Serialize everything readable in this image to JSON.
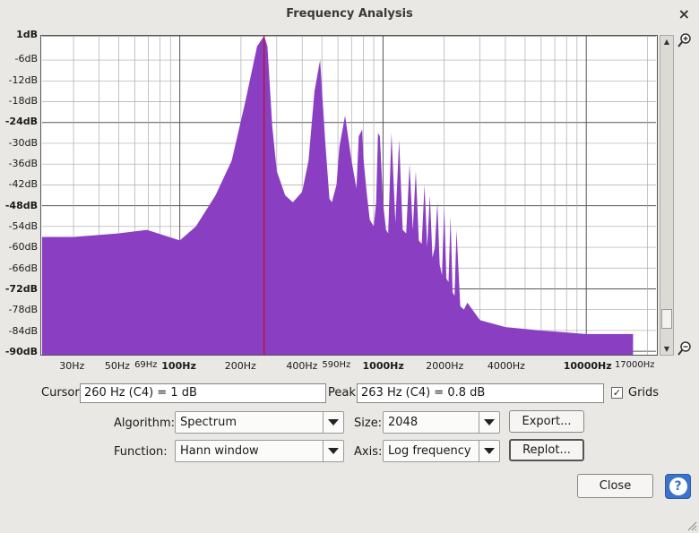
{
  "window": {
    "title": "Frequency Analysis",
    "close_glyph": "×"
  },
  "plot": {
    "y_axis_labels": [
      {
        "text": "1dB",
        "db": 1,
        "bold": true
      },
      {
        "text": "-6dB",
        "db": -6,
        "bold": false
      },
      {
        "text": "-12dB",
        "db": -12,
        "bold": false
      },
      {
        "text": "-18dB",
        "db": -18,
        "bold": false
      },
      {
        "text": "-24dB",
        "db": -24,
        "bold": true
      },
      {
        "text": "-30dB",
        "db": -30,
        "bold": false
      },
      {
        "text": "-36dB",
        "db": -36,
        "bold": false
      },
      {
        "text": "-42dB",
        "db": -42,
        "bold": false
      },
      {
        "text": "-48dB",
        "db": -48,
        "bold": true
      },
      {
        "text": "-54dB",
        "db": -54,
        "bold": false
      },
      {
        "text": "-60dB",
        "db": -60,
        "bold": false
      },
      {
        "text": "-66dB",
        "db": -66,
        "bold": false
      },
      {
        "text": "-72dB",
        "db": -72,
        "bold": true
      },
      {
        "text": "-78dB",
        "db": -78,
        "bold": false
      },
      {
        "text": "-84dB",
        "db": -84,
        "bold": false
      },
      {
        "text": "-90dB",
        "db": -90,
        "bold": true
      }
    ],
    "x_axis_labels": [
      {
        "text": "30Hz",
        "hz": 30,
        "style": "n"
      },
      {
        "text": "50Hz",
        "hz": 50,
        "style": "n"
      },
      {
        "text": "69Hz",
        "hz": 69,
        "style": "s"
      },
      {
        "text": "100Hz",
        "hz": 100,
        "style": "b"
      },
      {
        "text": "200Hz",
        "hz": 200,
        "style": "n"
      },
      {
        "text": "400Hz",
        "hz": 400,
        "style": "n"
      },
      {
        "text": "590Hz",
        "hz": 590,
        "style": "s"
      },
      {
        "text": "1000Hz",
        "hz": 1000,
        "style": "b"
      },
      {
        "text": "2000Hz",
        "hz": 2000,
        "style": "n"
      },
      {
        "text": "4000Hz",
        "hz": 4000,
        "style": "n"
      },
      {
        "text": "10000Hz",
        "hz": 10000,
        "style": "b"
      },
      {
        "text": "17000Hz",
        "hz": 17000,
        "style": "s"
      }
    ],
    "spectrum_color": "#8a3fc3",
    "cursor_color": "#cc0000",
    "cursor_hz": 260
  },
  "chart_data": {
    "type": "area",
    "x_scale": "log",
    "xlim_hz": [
      21,
      22050
    ],
    "ylim_db": [
      -91,
      1
    ],
    "grid": true,
    "x_hz": [
      21,
      30,
      50,
      69,
      100,
      120,
      150,
      180,
      210,
      240,
      260,
      270,
      285,
      300,
      330,
      360,
      400,
      430,
      460,
      490,
      520,
      545,
      560,
      590,
      610,
      650,
      700,
      740,
      760,
      790,
      800,
      830,
      860,
      900,
      925,
      945,
      965,
      1000,
      1035,
      1060,
      1100,
      1150,
      1200,
      1250,
      1300,
      1350,
      1400,
      1450,
      1500,
      1550,
      1600,
      1650,
      1700,
      1750,
      1800,
      1850,
      1900,
      1950,
      2000,
      2050,
      2100,
      2150,
      2200,
      2250,
      2300,
      2400,
      2500,
      2600,
      3000,
      4000,
      6000,
      10000,
      15000,
      17000
    ],
    "y_db": [
      -57,
      -57,
      -56,
      -55,
      -58,
      -54,
      -45,
      -35,
      -18,
      -2,
      1,
      -2,
      -25,
      -38,
      -45,
      -47,
      -44,
      -35,
      -15,
      -6,
      -30,
      -46,
      -47,
      -42,
      -31,
      -22,
      -35,
      -43,
      -28,
      -26,
      -34,
      -44,
      -52,
      -54,
      -47,
      -27,
      -28,
      -47,
      -55,
      -56,
      -27,
      -53,
      -29,
      -55,
      -56,
      -36,
      -55,
      -38,
      -58,
      -59,
      -42,
      -60,
      -45,
      -63,
      -60,
      -47,
      -65,
      -68,
      -48,
      -69,
      -70,
      -51,
      -73,
      -74,
      -55,
      -77,
      -78,
      -76,
      -81,
      -83,
      -84,
      -85,
      -85,
      -85
    ]
  },
  "cursor_field": {
    "label": "Cursor:",
    "value": "260 Hz (C4) = 1 dB"
  },
  "peak_field": {
    "label": "Peak:",
    "value": "263 Hz (C4) = 0.8 dB"
  },
  "grids": {
    "label": "Grids",
    "checked": true,
    "check_glyph": "✓"
  },
  "algorithm": {
    "label": "Algorithm:",
    "value": "Spectrum"
  },
  "size": {
    "label": "Size:",
    "value": "2048"
  },
  "function": {
    "label": "Function:",
    "value": "Hann window"
  },
  "axis": {
    "label": "Axis:",
    "value": "Log frequency"
  },
  "buttons": {
    "export": "Export...",
    "replot": "Replot...",
    "close": "Close",
    "help": "?"
  }
}
